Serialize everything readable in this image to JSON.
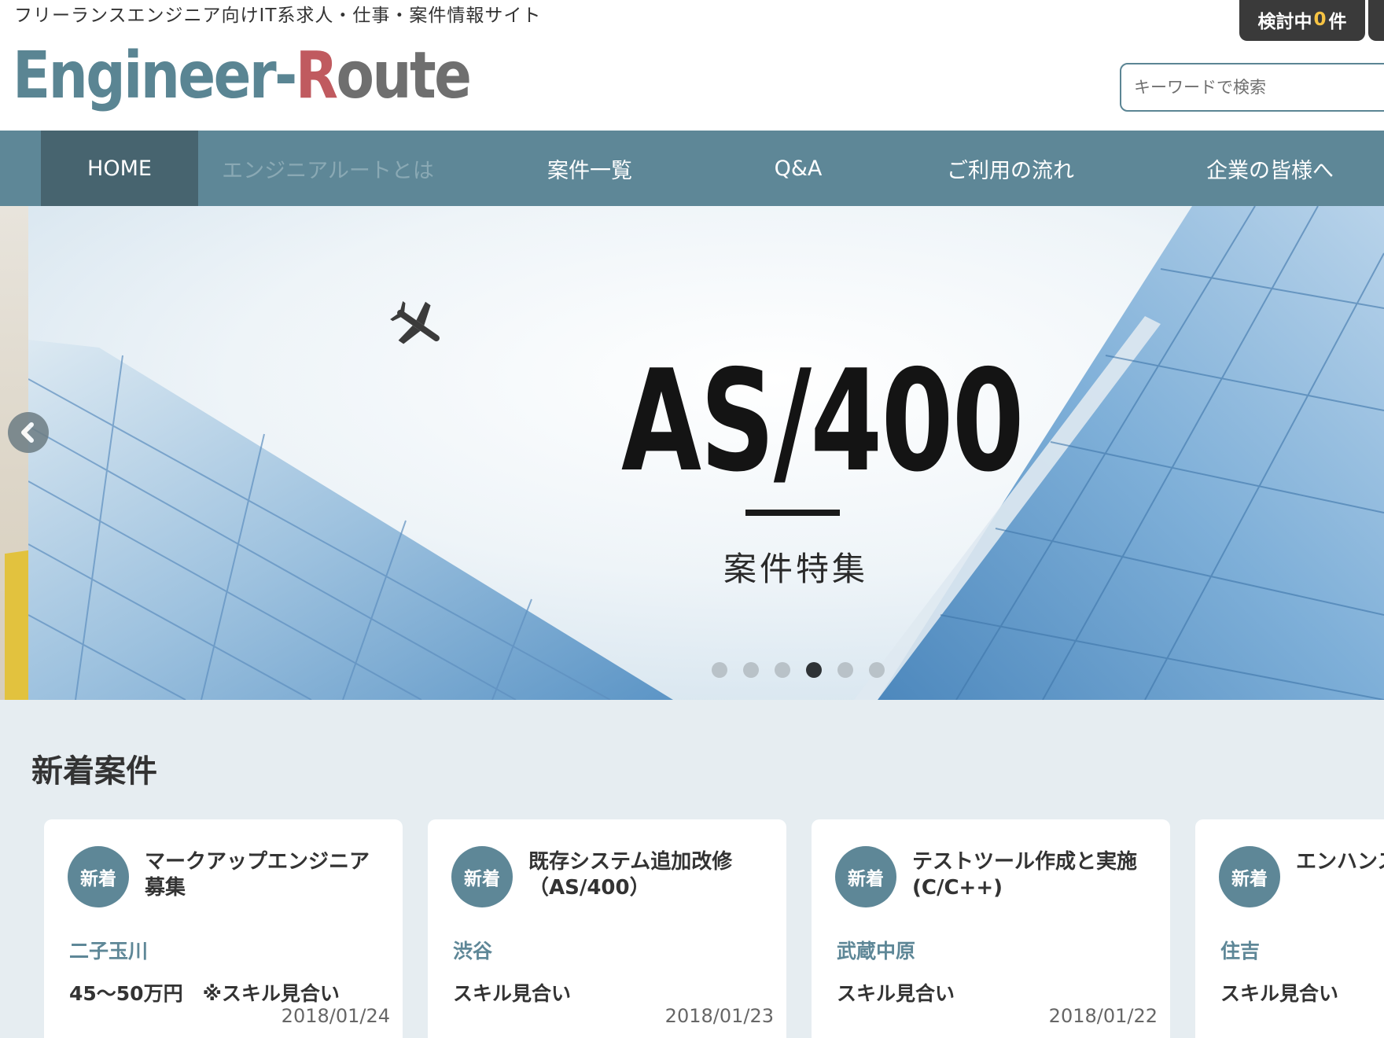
{
  "header": {
    "tagline": "フリーランスエンジニア向けIT系求人・仕事・案件情報サイト",
    "logo": {
      "part1": "Engineer-",
      "part2": "R",
      "part3": "oute"
    },
    "favorites": {
      "label_prefix": "検討中",
      "count": "0",
      "label_suffix": "件"
    },
    "search_placeholder": "キーワードで検索"
  },
  "nav": {
    "items": [
      {
        "label": "HOME"
      },
      {
        "label": "エンジニアルートとは"
      },
      {
        "label": "案件一覧"
      },
      {
        "label": "Q&A"
      },
      {
        "label": "ご利用の流れ"
      },
      {
        "label": "企業の皆様へ"
      }
    ]
  },
  "hero": {
    "title": "AS/400",
    "subtitle": "案件特集",
    "slides_total": 6,
    "active_slide": 4
  },
  "listings": {
    "section_title": "新着案件",
    "badge_label": "新着",
    "cards": [
      {
        "title": "マークアップエンジニア募集",
        "location": "二子玉川",
        "price": "45〜50万円　※スキル見合い",
        "date": "2018/01/24"
      },
      {
        "title": "既存システム追加改修（AS/400）",
        "location": "渋谷",
        "price": "スキル見合い",
        "date": "2018/01/23"
      },
      {
        "title": "テストツール作成と実施(C/C++)",
        "location": "武蔵中原",
        "price": "スキル見合い",
        "date": "2018/01/22"
      },
      {
        "title": "エンハンス",
        "location": "住吉",
        "price": "スキル見合い",
        "date": ""
      }
    ]
  },
  "colors": {
    "accent": "#5e8797",
    "nav_active": "#47646f",
    "section_bg": "#e6edf1",
    "logo_red": "#c05a5f"
  }
}
